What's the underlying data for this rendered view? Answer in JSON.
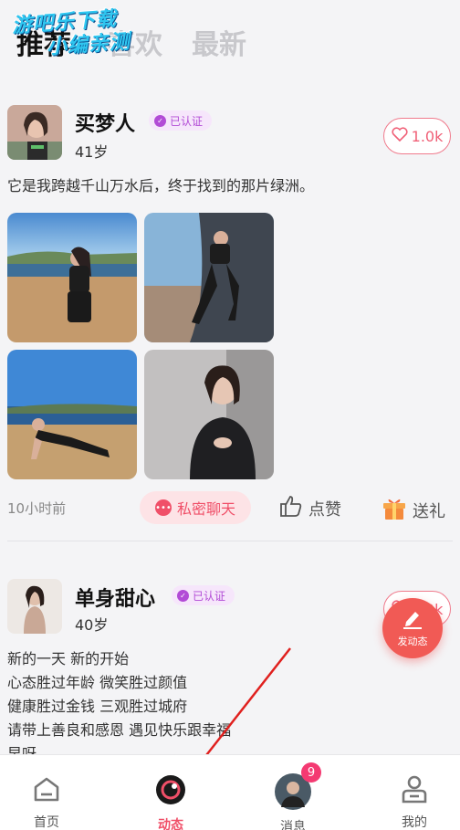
{
  "watermark": {
    "line1": "游吧乐下载",
    "line2": "小编亲测"
  },
  "tabs": [
    {
      "label": "推荐"
    },
    {
      "label": "喜欢"
    },
    {
      "label": "最新"
    }
  ],
  "post1": {
    "name": "买梦人",
    "badge": "已认证",
    "age": "41岁",
    "likes": "1.0k",
    "text": "它是我跨越千山万水后，终于找到的那片绿洲。",
    "time": "10小时前",
    "chat_label": "私密聊天",
    "like_label": "点赞",
    "gift_label": "送礼"
  },
  "post2": {
    "name": "单身甜心",
    "badge": "已认证",
    "age": "40岁",
    "likes": "1.0k",
    "text": "新的一天 新的开始\n心态胜过年龄 微笑胜过颜值\n 健康胜过金钱 三观胜过城府\n 请带上善良和感恩 遇见快乐跟幸福\n早呀"
  },
  "fab": {
    "label": "发动态"
  },
  "nav": [
    {
      "label": "首页",
      "icon": "home-icon"
    },
    {
      "label": "动态",
      "icon": "moments-icon"
    },
    {
      "label": "消息",
      "icon": "message-avatar-icon",
      "badge": "9"
    },
    {
      "label": "我的",
      "icon": "profile-icon"
    }
  ],
  "colors": {
    "accent": "#f04f68",
    "verified": "#b24bd6",
    "fab": "#f15a55"
  }
}
